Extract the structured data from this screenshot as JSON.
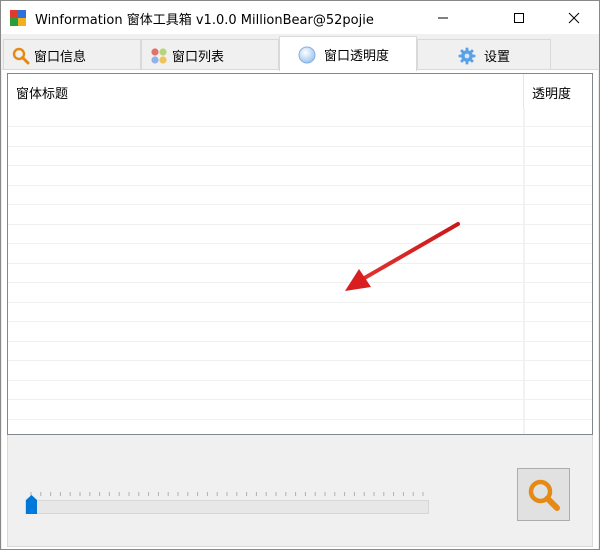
{
  "window": {
    "title": "Winformation 窗体工具箱 v1.0.0  MillionBear@52pojie",
    "icon": "app-logo-icon",
    "controls": [
      "minimize-icon",
      "maximize-icon",
      "close-icon"
    ]
  },
  "tabs": [
    {
      "label": "窗口信息",
      "icon": "search-icon",
      "active": false
    },
    {
      "label": "窗口列表",
      "icon": "grid-icon",
      "active": false
    },
    {
      "label": "窗口透明度",
      "icon": "circle-icon",
      "active": true
    },
    {
      "label": "设置",
      "icon": "gear-icon",
      "active": false
    }
  ],
  "list": {
    "columns": [
      "窗体标题",
      "透明度"
    ],
    "rows": []
  },
  "slider": {
    "value": 0,
    "tick_count": 41
  },
  "search_button": {
    "icon": "search-icon"
  },
  "colors": {
    "accent_orange": "#e58a14",
    "thumb_blue": "#0078d7",
    "arrow_red": "#d81e1e"
  }
}
